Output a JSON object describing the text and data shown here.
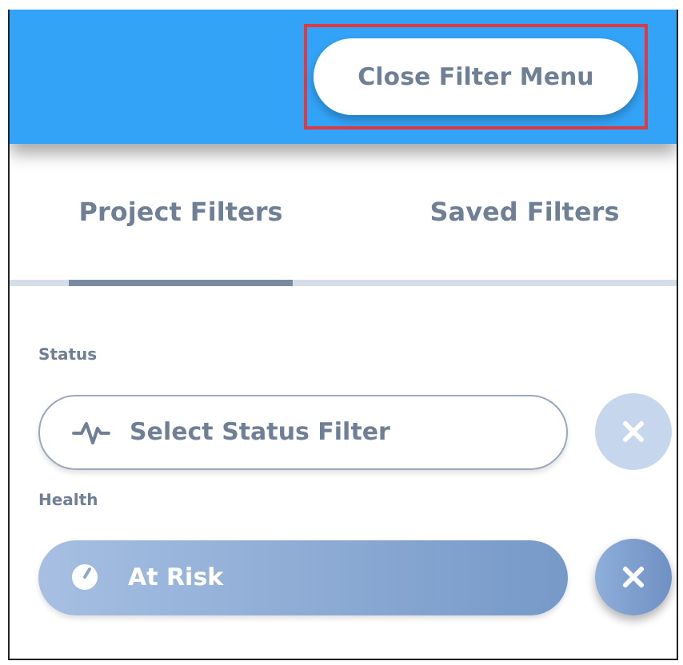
{
  "header": {
    "close_button": "Close Filter Menu",
    "highlighted": true
  },
  "tabs": [
    {
      "label": "Project Filters",
      "selected": true
    },
    {
      "label": "Saved Filters",
      "selected": false
    }
  ],
  "filters": [
    {
      "kind": "status",
      "label": "Status",
      "placeholder": "Select Status Filter",
      "active": false
    },
    {
      "kind": "health",
      "label": "Health",
      "value": "At Risk",
      "active": true
    }
  ]
}
